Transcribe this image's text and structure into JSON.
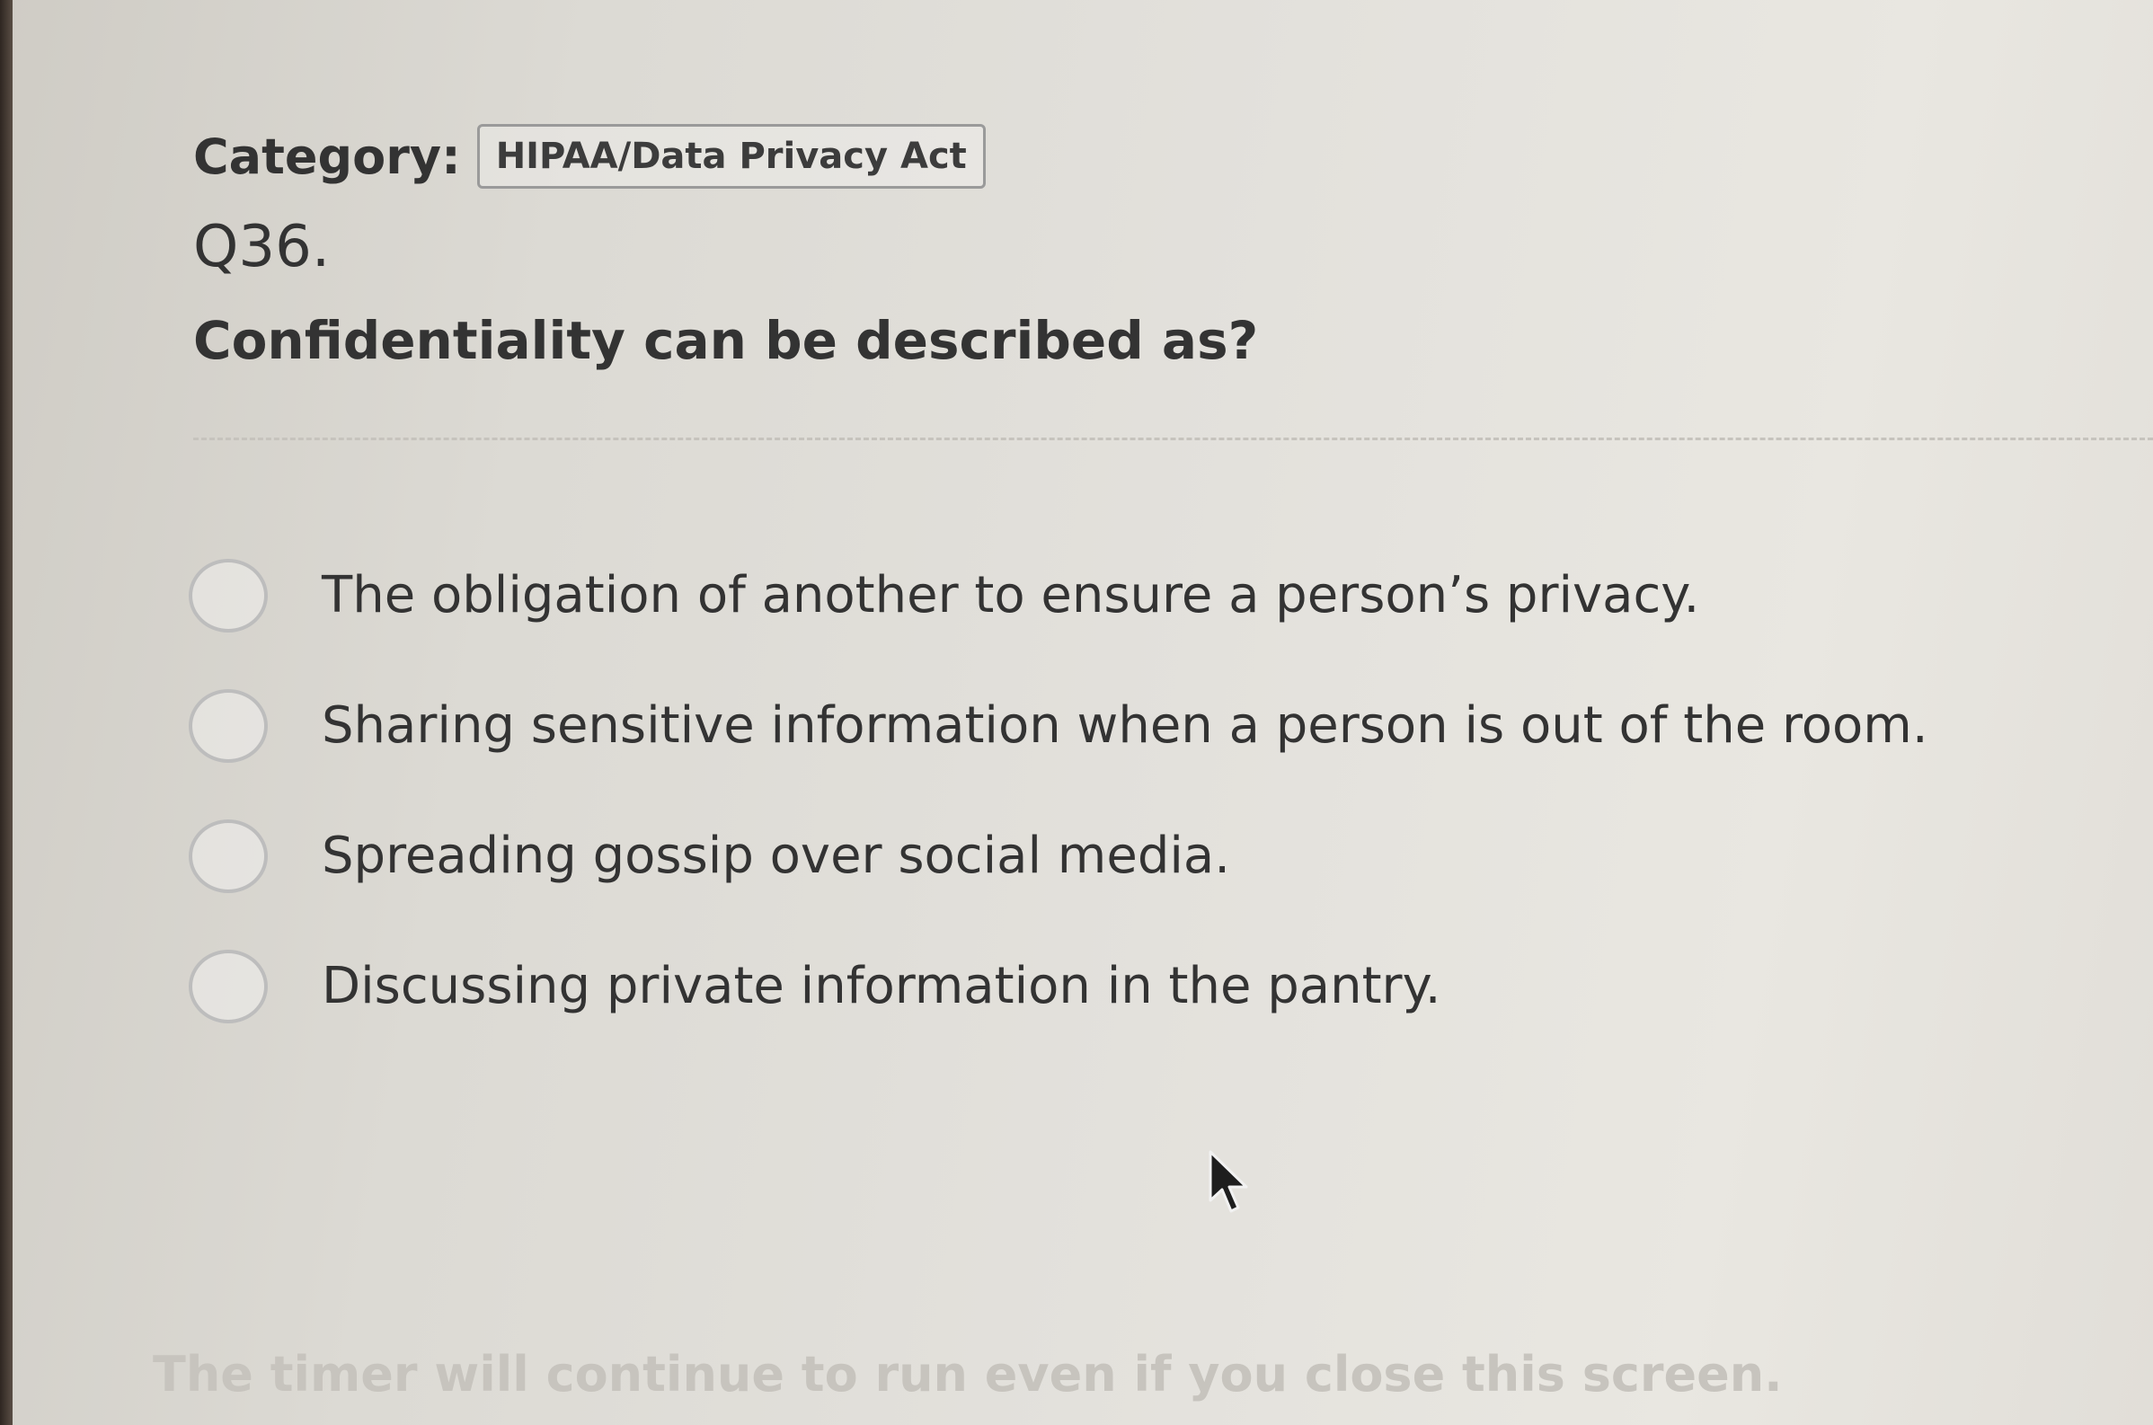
{
  "category": {
    "label": "Category:",
    "value": "HIPAA/Data Privacy Act"
  },
  "question": {
    "number": "Q36.",
    "text": "Confidentiality can be described as?"
  },
  "options": [
    {
      "label": "The obligation of another to ensure a person’s privacy.",
      "selected": false
    },
    {
      "label": "Sharing sensitive information when a person is out of the room.",
      "selected": false
    },
    {
      "label": "Spreading gossip over social media.",
      "selected": false
    },
    {
      "label": "Discussing private information in the pantry.",
      "selected": false
    }
  ],
  "footer": {
    "timer_note": "The timer will continue to run even if you close this screen."
  },
  "icons": {
    "cursor": "mouse-pointer-icon",
    "radio": "radio-unchecked-icon"
  },
  "colors": {
    "text": "#333333",
    "radio_border": "#bdbdbd",
    "timer_note": "#c7c4be"
  }
}
